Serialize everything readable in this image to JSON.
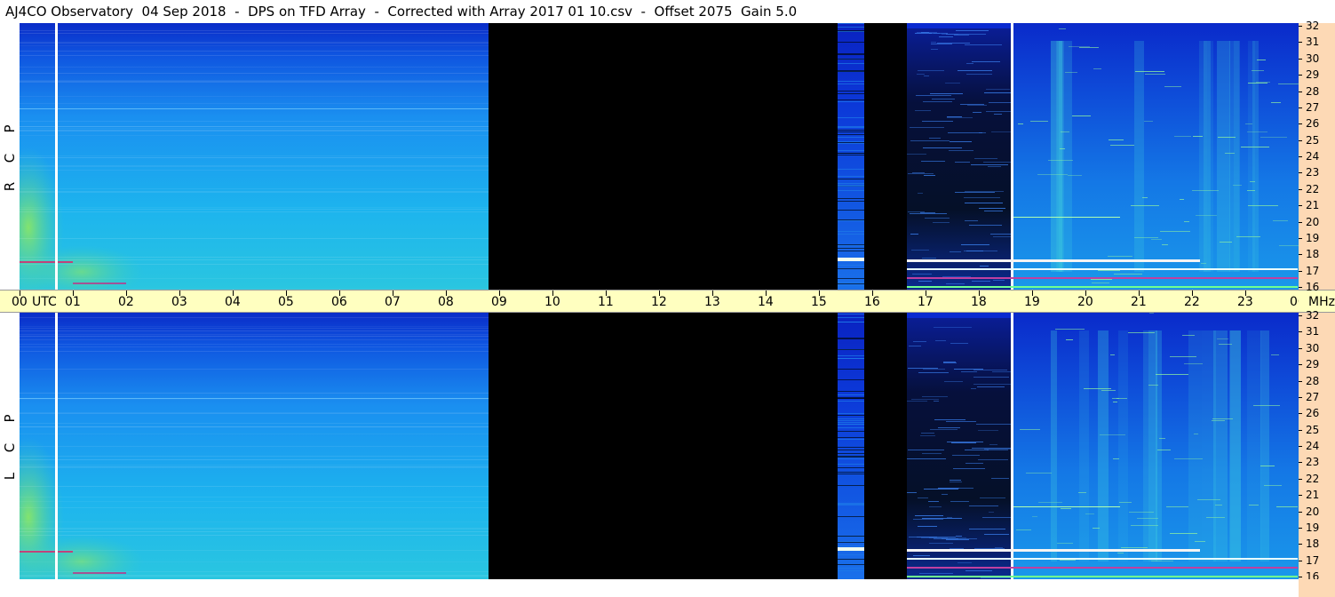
{
  "title": "AJ4CO Observatory  04 Sep 2018  -  DPS on TFD Array  -  Corrected with Array 2017 01 10.csv  -  Offset 2075  Gain 5.0",
  "panels": [
    {
      "id": "rcp",
      "letters": [
        "R",
        "C",
        "P"
      ]
    },
    {
      "id": "lcp",
      "letters": [
        "L",
        "C",
        "P"
      ]
    }
  ],
  "time_axis": {
    "labels": [
      "00",
      "01",
      "02",
      "03",
      "04",
      "05",
      "06",
      "07",
      "08",
      "09",
      "10",
      "11",
      "12",
      "13",
      "14",
      "15",
      "16",
      "17",
      "18",
      "19",
      "20",
      "21",
      "22",
      "23",
      "00"
    ],
    "start_unit": "UTC",
    "end_unit": "MHz"
  },
  "freq_axis": {
    "labels": [
      "32",
      "31",
      "30",
      "29",
      "28",
      "27",
      "26",
      "25",
      "24",
      "23",
      "22",
      "21",
      "20",
      "19",
      "18",
      "17",
      "16"
    ]
  },
  "colors": {
    "title_bg": "#ffffff",
    "time_axis_bg": "#ffffc0",
    "freq_axis_bg": "#fdd9b5",
    "no_data": "#000000",
    "spectrum_low": "#0a2fd0",
    "spectrum_mid": "#1aa8f0",
    "spectrum_high": "#30e0c0"
  }
}
